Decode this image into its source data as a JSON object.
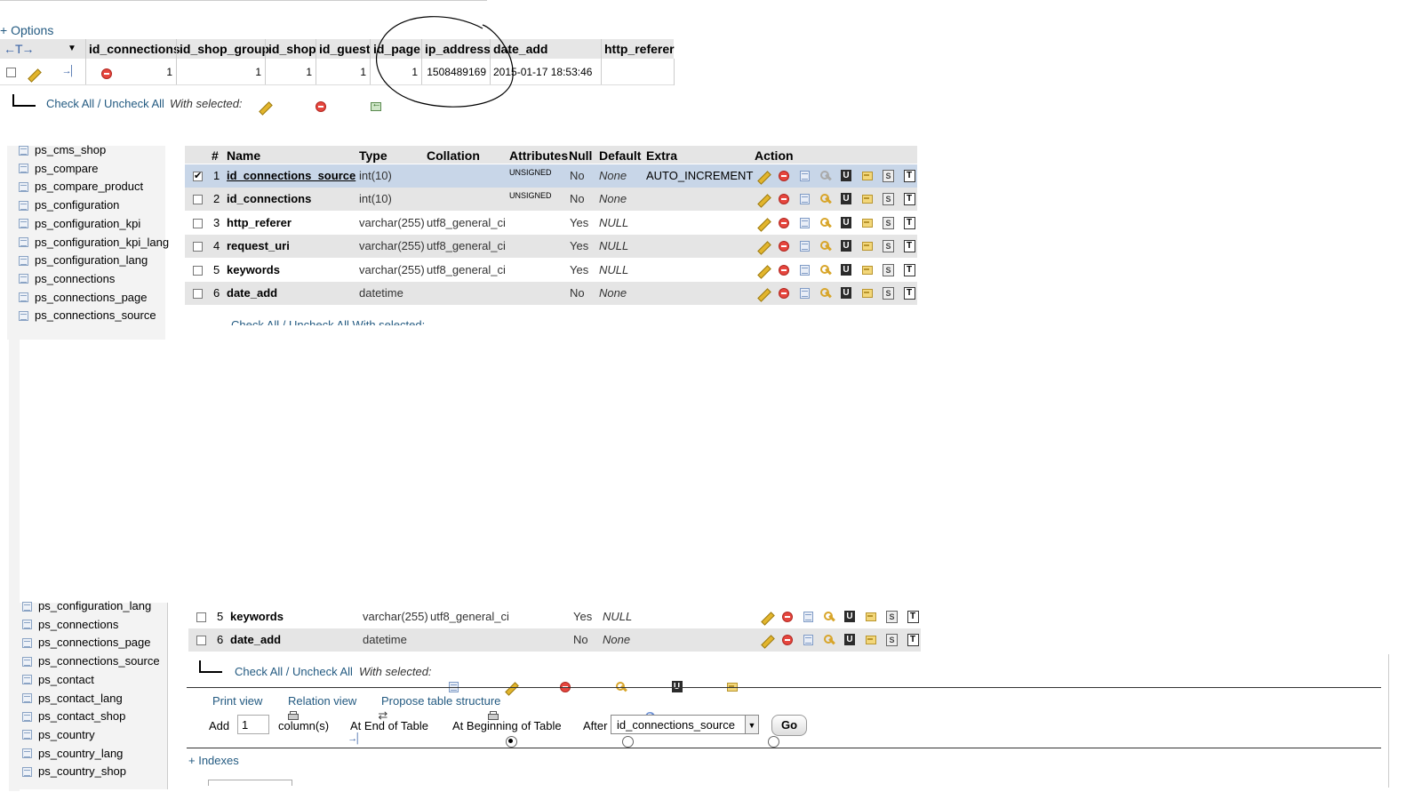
{
  "top": {
    "options_label": "+ Options",
    "sort_arrows": "←T→",
    "columns": [
      "id_connections",
      "id_shop_group",
      "id_shop",
      "id_guest",
      "id_page",
      "ip_address",
      "date_add",
      "http_referer"
    ],
    "row": [
      "1",
      "1",
      "1",
      "1",
      "1",
      "1508489169",
      "2015-01-17 18:53:46",
      ""
    ],
    "check_all": "Check All / Uncheck All",
    "with_selected": "With selected:"
  },
  "structure": {
    "columns": {
      "num": "#",
      "name": "Name",
      "type": "Type",
      "collation": "Collation",
      "attributes": "Attributes",
      "null": "Null",
      "default": "Default",
      "extra": "Extra",
      "action": "Action"
    },
    "rows": [
      {
        "num": "1",
        "name": "id_connections_source",
        "type": "int(10)",
        "collation": "",
        "attributes": "UNSIGNED",
        "null": "No",
        "default": "None",
        "extra": "AUTO_INCREMENT",
        "checked": true
      },
      {
        "num": "2",
        "name": "id_connections",
        "type": "int(10)",
        "collation": "",
        "attributes": "UNSIGNED",
        "null": "No",
        "default": "None",
        "extra": ""
      },
      {
        "num": "3",
        "name": "http_referer",
        "type": "varchar(255)",
        "collation": "utf8_general_ci",
        "attributes": "",
        "null": "Yes",
        "default": "NULL",
        "extra": ""
      },
      {
        "num": "4",
        "name": "request_uri",
        "type": "varchar(255)",
        "collation": "utf8_general_ci",
        "attributes": "",
        "null": "Yes",
        "default": "NULL",
        "extra": ""
      },
      {
        "num": "5",
        "name": "keywords",
        "type": "varchar(255)",
        "collation": "utf8_general_ci",
        "attributes": "",
        "null": "Yes",
        "default": "NULL",
        "extra": ""
      },
      {
        "num": "6",
        "name": "date_add",
        "type": "datetime",
        "collation": "",
        "attributes": "",
        "null": "No",
        "default": "None",
        "extra": ""
      }
    ],
    "check_all_cut": "Check All / Uncheck All With selected:"
  },
  "sidebar_top": [
    "ps_cms_shop",
    "ps_compare",
    "ps_compare_product",
    "ps_configuration",
    "ps_configuration_kpi",
    "ps_configuration_kpi_lang",
    "ps_configuration_lang",
    "ps_connections",
    "ps_connections_page",
    "ps_connections_source"
  ],
  "sidebar_bottom": [
    "ps_configuration_lang",
    "ps_connections",
    "ps_connections_page",
    "ps_connections_source",
    "ps_contact",
    "ps_contact_lang",
    "ps_contact_shop",
    "ps_country",
    "ps_country_lang",
    "ps_country_shop"
  ],
  "bottom": {
    "rows": [
      {
        "num": "5",
        "name": "keywords",
        "type": "varchar(255)",
        "collation": "utf8_general_ci",
        "null": "Yes",
        "default": "NULL"
      },
      {
        "num": "6",
        "name": "date_add",
        "type": "datetime",
        "collation": "",
        "null": "No",
        "default": "None"
      }
    ],
    "check_all": "Check All / Uncheck All",
    "with_selected": "With selected:",
    "print_view": "Print view",
    "relation_view": "Relation view",
    "propose": "Propose table structure",
    "add": "Add",
    "add_count": "1",
    "columns_label": "column(s)",
    "at_end": "At End of Table",
    "at_beginning": "At Beginning of Table",
    "after": "After",
    "after_select": "id_connections_source",
    "go": "Go",
    "indexes": "+ Indexes"
  }
}
